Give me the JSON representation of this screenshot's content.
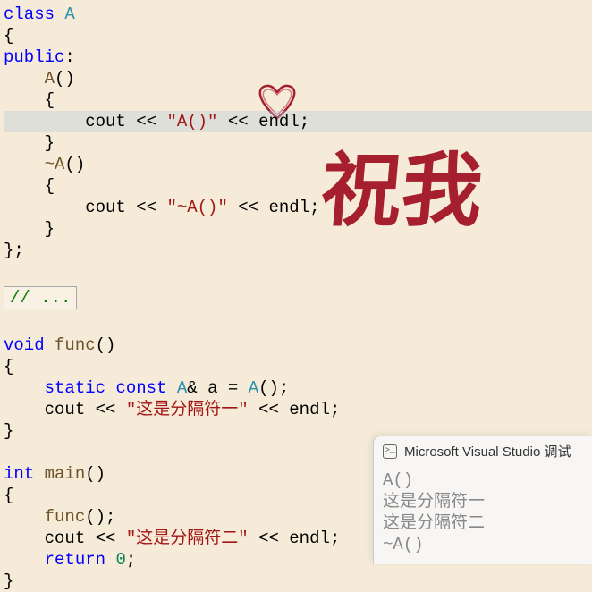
{
  "code": {
    "l1_class": "class",
    "l1_A": "A",
    "l2": "{",
    "l3_public": "public",
    "l3_colon": ":",
    "l4_A": "A",
    "l4_paren": "()",
    "l5": "{",
    "l6_cout": "cout",
    "l6_op1": "<<",
    "l6_str": "\"A()\"",
    "l6_op2": "<<",
    "l6_endl": "endl",
    "l6_semi": ";",
    "l7": "}",
    "l8_dtor": "~A",
    "l8_paren": "()",
    "l9": "{",
    "l10_cout": "cout",
    "l10_op1": "<<",
    "l10_str": "\"~A()\"",
    "l10_op2": "<<",
    "l10_endl": "endl",
    "l10_semi": ";",
    "l11": "}",
    "l12": "};",
    "collapsed": "// ...",
    "l14_void": "void",
    "l14_func": "func",
    "l14_paren": "()",
    "l15": "{",
    "l16_static": "static",
    "l16_const": "const",
    "l16_A": "A",
    "l16_amp": "&",
    "l16_a": "a",
    "l16_eq": "=",
    "l16_A2": "A",
    "l16_paren": "()",
    "l16_semi": ";",
    "l17_cout": "cout",
    "l17_op1": "<<",
    "l17_str": "\"这是分隔符一\"",
    "l17_op2": "<<",
    "l17_endl": "endl",
    "l17_semi": ";",
    "l18": "}",
    "l20_int": "int",
    "l20_main": "main",
    "l20_paren": "()",
    "l21": "{",
    "l22_func": "func",
    "l22_paren": "()",
    "l22_semi": ";",
    "l23_cout": "cout",
    "l23_op1": "<<",
    "l23_str": "\"这是分隔符二\"",
    "l23_op2": "<<",
    "l23_endl": "endl",
    "l23_semi": ";",
    "l24_return": "return",
    "l24_zero": "0",
    "l24_semi": ";",
    "l25": "}"
  },
  "console": {
    "title": "Microsoft Visual Studio 调试",
    "lines": [
      "A()",
      "这是分隔符一",
      "这是分隔符二",
      "~A()"
    ]
  },
  "deco": {
    "calligraphy": "祝我"
  }
}
